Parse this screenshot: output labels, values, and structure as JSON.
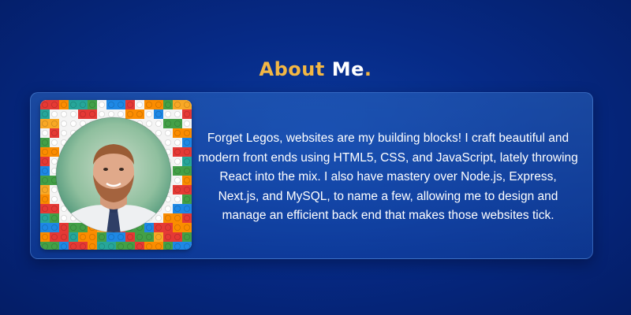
{
  "section": {
    "heading_accent": "About",
    "heading_rest": "Me",
    "heading_dot": "."
  },
  "about": {
    "bio": "Forget Legos, websites are my building blocks! I craft beautiful and modern front ends using HTML5, CSS, and JavaScript, lately throwing React into the mix. I also have mastery over Node.js, Express, Next.js, and MySQL, to name a few, allowing me to design and manage an efficient back end that makes those websites tick."
  },
  "colors": {
    "accent": "#f3b744",
    "background": "#062a86",
    "text": "#ffffff"
  },
  "icons": {
    "portrait": "profile-photo",
    "backdrop": "lego-bricks-pattern"
  }
}
